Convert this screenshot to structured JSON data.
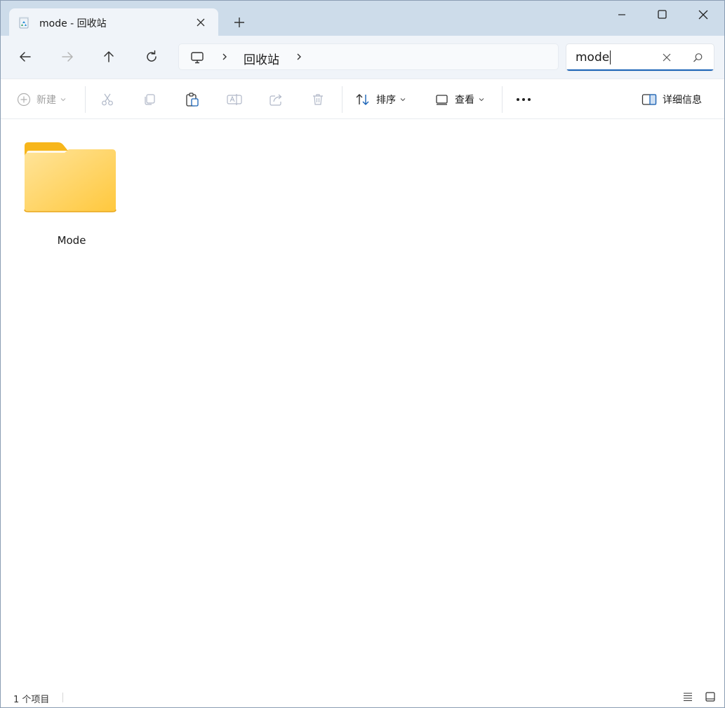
{
  "tab": {
    "title": "mode - 回收站",
    "icon": "recycle-bin-icon"
  },
  "window_controls": [
    "minimize-icon",
    "maximize-icon",
    "close-icon"
  ],
  "address_bar": {
    "root_icon": "this-pc-icon",
    "location": "回收站"
  },
  "search": {
    "value": "mode"
  },
  "command_bar": {
    "new_label": "新建",
    "sort_label": "排序",
    "view_label": "查看",
    "details_label": "详细信息"
  },
  "items": [
    {
      "name": "Mode",
      "icon": "folder-icon"
    }
  ],
  "status": {
    "count_text": "1 个项目"
  },
  "colors": {
    "titlebar": "#cddcea",
    "navbar": "#f0f4f9",
    "accent": "#1a63b7",
    "folder": "#ffc83d"
  }
}
